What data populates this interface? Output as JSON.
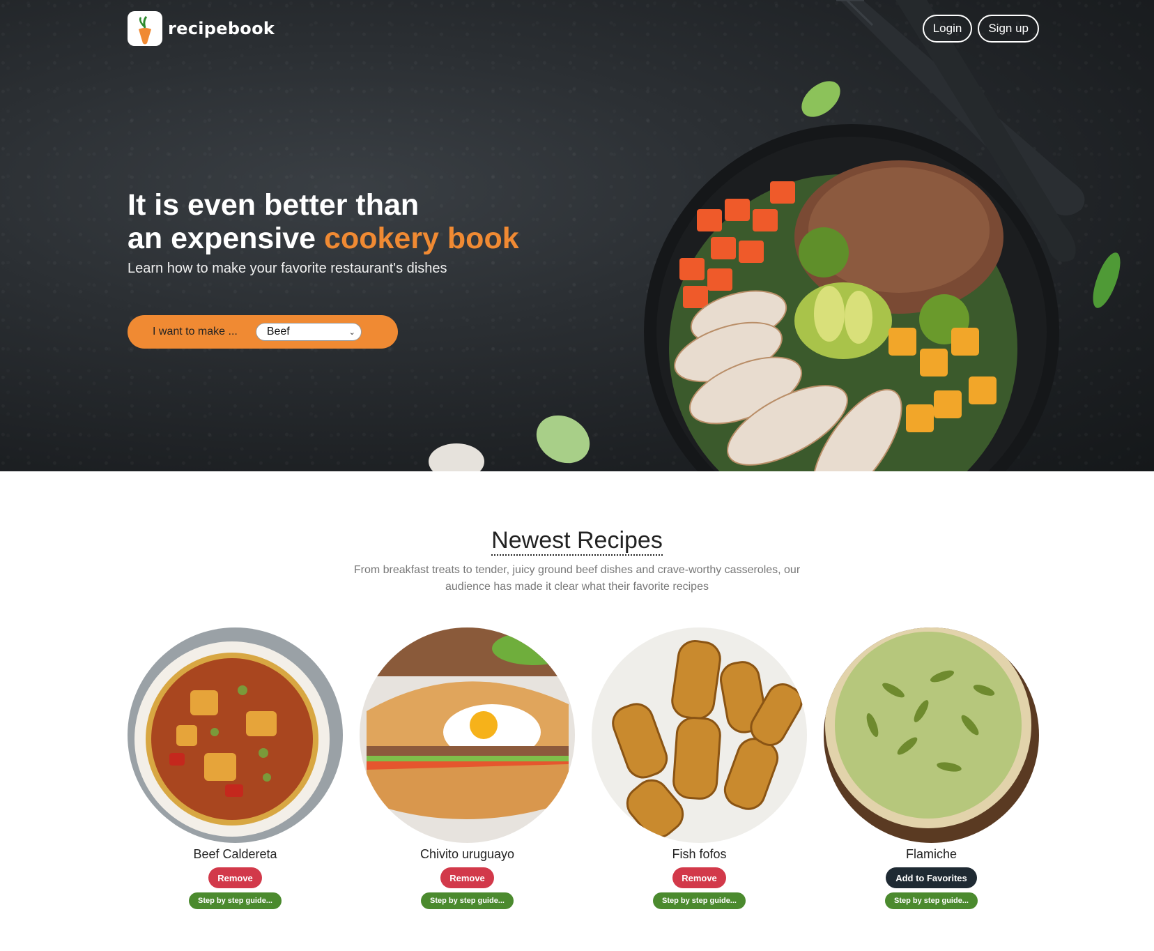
{
  "header": {
    "brand": "recipebook",
    "login_label": "Login",
    "signup_label": "Sign up"
  },
  "hero": {
    "title_line1": "It is even better than",
    "title_line2_prefix": "an expensive ",
    "title_line2_accent": "cookery book",
    "subtitle": "Learn how to make your favorite restaurant's dishes",
    "make_label": "I want to make ...",
    "make_value": "Beef"
  },
  "newest": {
    "title": "Newest Recipes",
    "description": "From breakfast treats to tender, juicy ground beef dishes and crave-worthy casseroles, our audience has made it clear what their favorite recipes",
    "recipes": [
      {
        "name": "Beef Caldereta",
        "action": "Remove",
        "guide": "Step by step guide..."
      },
      {
        "name": "Chivito uruguayo",
        "action": "Remove",
        "guide": "Step by step guide..."
      },
      {
        "name": "Fish fofos",
        "action": "Remove",
        "guide": "Step by step guide..."
      },
      {
        "name": "Flamiche",
        "action": "Add to Favorites",
        "guide": "Step by step guide..."
      }
    ]
  },
  "colors": {
    "accent": "#f08a33",
    "remove": "#d2394a",
    "favorites": "#1f2a33",
    "guide": "#4b8a2e"
  }
}
